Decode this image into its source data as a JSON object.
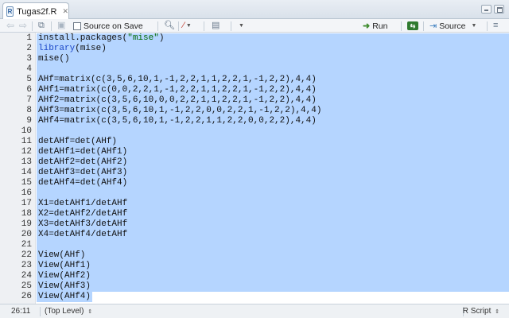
{
  "tab": {
    "title": "Tugas2f.R",
    "file_icon": "r-file-icon",
    "close_icon": "close-icon"
  },
  "toolbar": {
    "source_on_save_label": "Source on Save",
    "source_on_save_checked": false,
    "run_label": "Run",
    "source_label": "Source",
    "icons": [
      "back-arrow-icon",
      "forward-arrow-icon",
      "show-in-window-icon",
      "save-icon",
      "search-icon",
      "code-tools-wand-icon",
      "compile-report-icon",
      "rerun-icon",
      "source-icon"
    ]
  },
  "editor": {
    "selected_lines": "1-26",
    "selection_color": "#b5d5ff",
    "lines": [
      {
        "n": "1",
        "text": "install.packages(\"mise\")"
      },
      {
        "n": "2",
        "text": "library(mise)"
      },
      {
        "n": "3",
        "text": "mise()"
      },
      {
        "n": "4",
        "text": ""
      },
      {
        "n": "5",
        "text": "AHf=matrix(c(3,5,6,10,1,-1,2,2,1,1,2,2,1,-1,2,2),4,4)"
      },
      {
        "n": "6",
        "text": "AHf1=matrix(c(0,0,2,2,1,-1,2,2,1,1,2,2,1,-1,2,2),4,4)"
      },
      {
        "n": "7",
        "text": "AHf2=matrix(c(3,5,6,10,0,0,2,2,1,1,2,2,1,-1,2,2),4,4)"
      },
      {
        "n": "8",
        "text": "AHf3=matrix(c(3,5,6,10,1,-1,2,2,0,0,2,2,1,-1,2,2),4,4)"
      },
      {
        "n": "9",
        "text": "AHf4=matrix(c(3,5,6,10,1,-1,2,2,1,1,2,2,0,0,2,2),4,4)"
      },
      {
        "n": "10",
        "text": ""
      },
      {
        "n": "11",
        "text": "detAHf=det(AHf)"
      },
      {
        "n": "12",
        "text": "detAHf1=det(AHf1)"
      },
      {
        "n": "13",
        "text": "detAHf2=det(AHf2)"
      },
      {
        "n": "14",
        "text": "detAHf3=det(AHf3)"
      },
      {
        "n": "15",
        "text": "detAHf4=det(AHf4)"
      },
      {
        "n": "16",
        "text": ""
      },
      {
        "n": "17",
        "text": "X1=detAHf1/detAHf"
      },
      {
        "n": "18",
        "text": "X2=detAHf2/detAHf"
      },
      {
        "n": "19",
        "text": "X3=detAHf3/detAHf"
      },
      {
        "n": "20",
        "text": "X4=detAHf4/detAHf"
      },
      {
        "n": "21",
        "text": ""
      },
      {
        "n": "22",
        "text": "View(AHf)"
      },
      {
        "n": "23",
        "text": "View(AHf1)"
      },
      {
        "n": "24",
        "text": "View(AHf2)"
      },
      {
        "n": "25",
        "text": "View(AHf3)"
      },
      {
        "n": "26",
        "text": "View(AHf4)"
      }
    ]
  },
  "status": {
    "position": "26:11",
    "scope": "(Top Level)",
    "file_type": "R Script"
  }
}
